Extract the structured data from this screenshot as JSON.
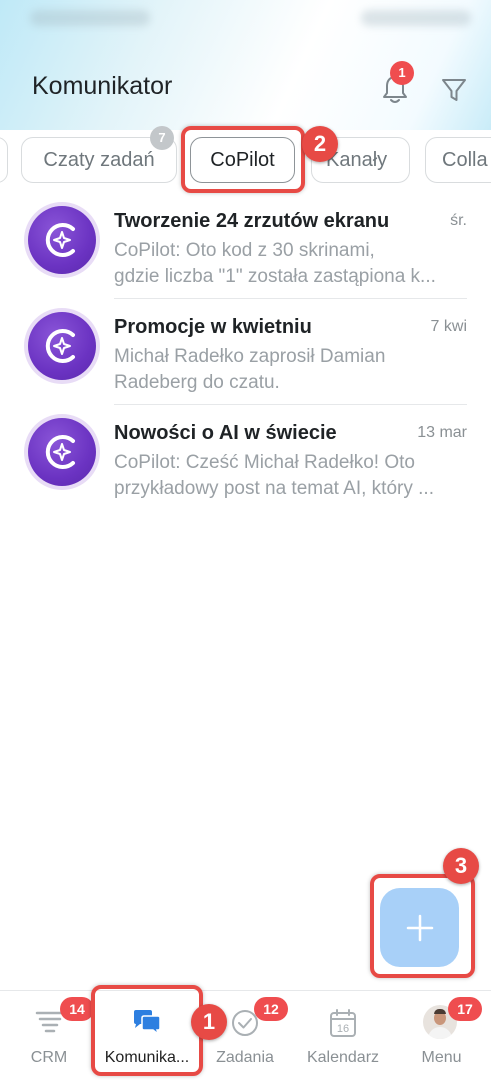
{
  "header": {
    "title": "Komunikator",
    "notification_count": "1"
  },
  "filters": {
    "items": [
      {
        "label": "Czaty zadań",
        "count": "7"
      },
      {
        "label": "CoPilot"
      },
      {
        "label": "Kanały"
      },
      {
        "label": "Colla"
      }
    ]
  },
  "chats": [
    {
      "title": "Tworzenie 24 zrzutów ekranu",
      "time": "śr.",
      "preview_line1": "CoPilot: Oto kod z 30 skrinami,",
      "preview_line2": "gdzie liczba \"1\" została zastąpiona k..."
    },
    {
      "title": "Promocje w kwietniu",
      "time": "7 kwi",
      "preview_line1": "Michał Radełko zaprosił Damian",
      "preview_line2": "Radeberg do czatu."
    },
    {
      "title": "Nowości o AI w świecie",
      "time": "13 mar",
      "preview_line1": "CoPilot: Cześć Michał Radełko! Oto",
      "preview_line2": "przykładowy post na temat AI, który ..."
    }
  ],
  "fab": {
    "label": "+"
  },
  "callouts": [
    "1",
    "2",
    "3"
  ],
  "bottom_nav": {
    "items": [
      {
        "label": "CRM",
        "badge": "14"
      },
      {
        "label": "Komunika...",
        "badge": ""
      },
      {
        "label": "Zadania",
        "badge": "12"
      },
      {
        "label": "Kalendarz",
        "badge": "",
        "day": "16"
      },
      {
        "label": "Menu",
        "badge": "17"
      }
    ]
  },
  "colors": {
    "accent": "#2d7fe0",
    "badge": "#ef4d4f",
    "callout": "#e74a45",
    "copilot_avatar": "#6b33c2",
    "fab": "#a8d0f8"
  }
}
